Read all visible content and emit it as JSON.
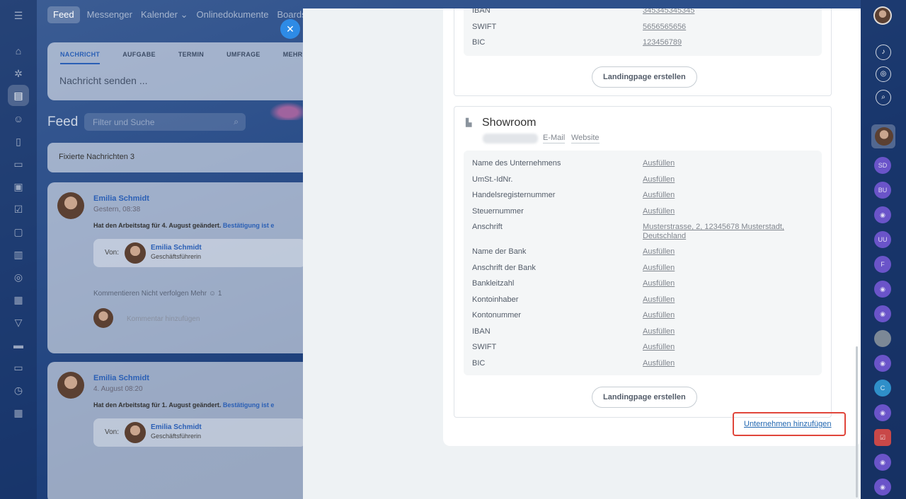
{
  "nav": {
    "items": [
      "Feed",
      "Messenger",
      "Kalender",
      "Onlinedokumente",
      "Boards"
    ]
  },
  "composer": {
    "tabs": [
      "NACHRICHT",
      "AUFGABE",
      "TERMIN",
      "UMFRAGE",
      "MEHR"
    ],
    "placeholder": "Nachricht senden ..."
  },
  "feed": {
    "title": "Feed",
    "search_placeholder": "Filter und Suche",
    "pinned": "Fixierte Nachrichten 3",
    "posts": [
      {
        "author": "Emilia Schmidt",
        "time": "Gestern, 08:38",
        "text": "Hat den Arbeitstag für 4. August geändert.",
        "link": "Bestätigung ist e",
        "von_label": "Von:",
        "von_name": "Emilia Schmidt",
        "von_role": "Geschäftsführerin",
        "actions": "Kommentieren   Nicht verfolgen   Mehr     ☺ 1",
        "comment_placeholder": "Kommentar hinzufügen"
      },
      {
        "author": "Emilia Schmidt",
        "time": "4. August 08:20",
        "text": "Hat den Arbeitstag für 1. August geändert.",
        "link": "Bestätigung ist e",
        "von_label": "Von:",
        "von_name": "Emilia Schmidt",
        "von_role": "Geschäftsführerin"
      }
    ]
  },
  "slider": {
    "top_company": {
      "rows": [
        {
          "label": "IBAN",
          "value": "345345345345"
        },
        {
          "label": "SWIFT",
          "value": "5656565656"
        },
        {
          "label": "BIC",
          "value": "123456789"
        }
      ],
      "landing_button": "Landingpage erstellen"
    },
    "showroom": {
      "title": "Showroom",
      "email_link": "E-Mail",
      "website_link": "Website",
      "rows": [
        {
          "label": "Name des Unternehmens",
          "value": "Ausfüllen"
        },
        {
          "label": "UmSt.-IdNr.",
          "value": "Ausfüllen"
        },
        {
          "label": "Handelsregisternummer",
          "value": "Ausfüllen"
        },
        {
          "label": "Steuernummer",
          "value": "Ausfüllen"
        },
        {
          "label": "Anschrift",
          "value": "Musterstrasse, 2, 12345678 Musterstadt, Deutschland"
        },
        {
          "label": "Name der Bank",
          "value": "Ausfüllen"
        },
        {
          "label": "Anschrift der Bank",
          "value": "Ausfüllen"
        },
        {
          "label": "Bankleitzahl",
          "value": "Ausfüllen"
        },
        {
          "label": "Kontoinhaber",
          "value": "Ausfüllen"
        },
        {
          "label": "Kontonummer",
          "value": "Ausfüllen"
        },
        {
          "label": "IBAN",
          "value": "Ausfüllen"
        },
        {
          "label": "SWIFT",
          "value": "Ausfüllen"
        },
        {
          "label": "BIC",
          "value": "Ausfüllen"
        }
      ],
      "landing_button": "Landingpage erstellen"
    },
    "add_company": "Unternehmen hinzufügen"
  },
  "right_bar": {
    "badges": [
      "SD",
      "BU",
      "UU",
      "F",
      "C"
    ]
  },
  "colors": {
    "accent": "#2066b0",
    "highlight": "#e0453a",
    "close": "#2e8be6"
  }
}
